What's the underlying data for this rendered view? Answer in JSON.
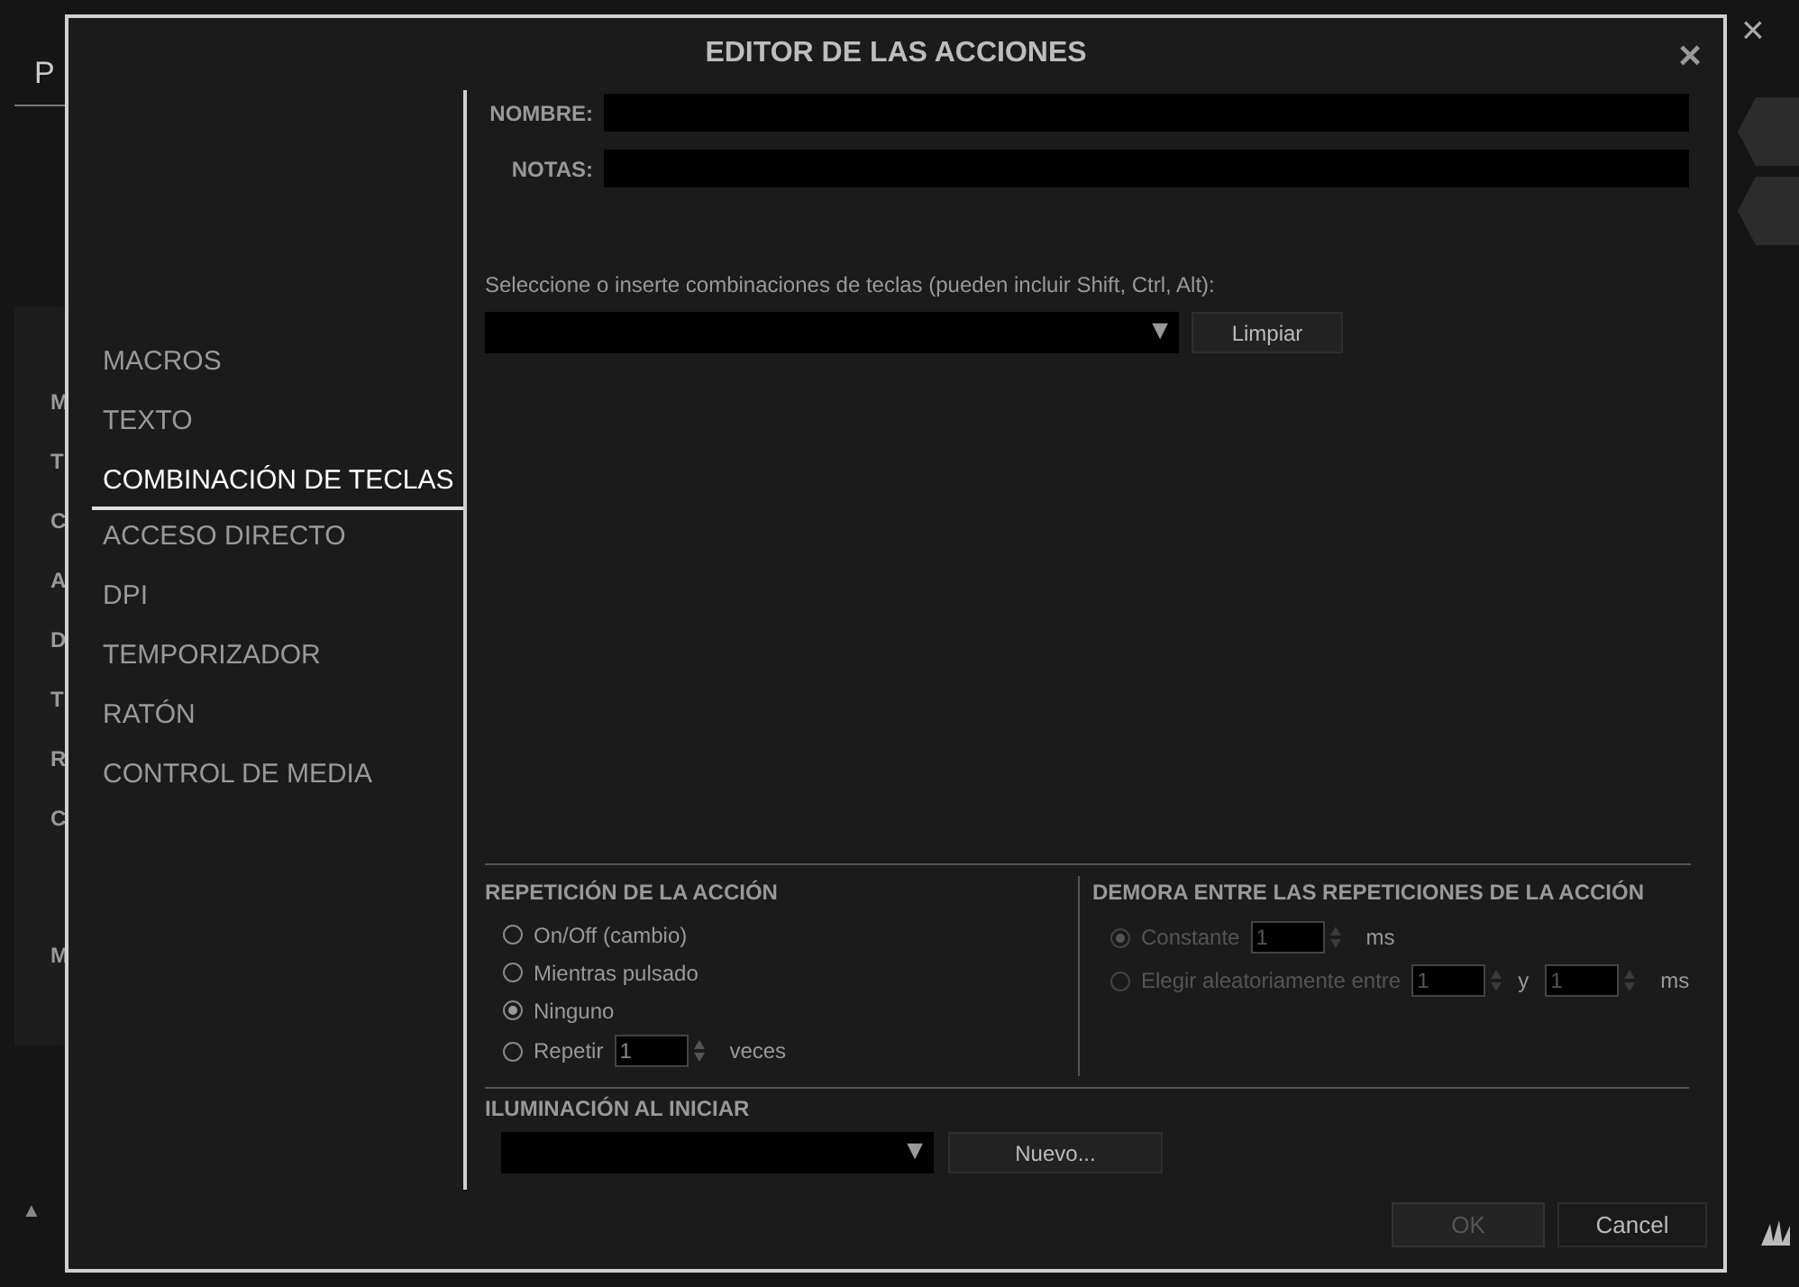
{
  "background": {
    "tab_label": "P",
    "close": "×",
    "side_letters": [
      "M",
      "T",
      "C",
      "A",
      "D",
      "T",
      "R",
      "C",
      "M"
    ],
    "corner_arrow": "▲"
  },
  "dialog": {
    "title": "EDITOR DE LAS ACCIONES",
    "close": "×",
    "sidebar": [
      {
        "label": "MACROS",
        "selected": false
      },
      {
        "label": "TEXTO",
        "selected": false
      },
      {
        "label": "COMBINACIÓN DE TECLAS",
        "selected": true
      },
      {
        "label": "ACCESO DIRECTO",
        "selected": false
      },
      {
        "label": "DPI",
        "selected": false
      },
      {
        "label": "TEMPORIZADOR",
        "selected": false
      },
      {
        "label": "RATÓN",
        "selected": false
      },
      {
        "label": "CONTROL DE MEDIA",
        "selected": false
      }
    ],
    "name_label": "NOMBRE:",
    "notes_label": "NOTAS:",
    "keys_prompt": "Seleccione o inserte combinaciones de teclas (pueden incluir Shift, Ctrl, Alt):",
    "keys_dropdown_arrow": "▼",
    "clear_button": "Limpiar",
    "repeat": {
      "title": "REPETICIÓN DE LA ACCIÓN",
      "options": [
        {
          "kind": "plain",
          "label": "On/Off (cambio)",
          "selected": false
        },
        {
          "kind": "plain",
          "label": "Mientras pulsado",
          "selected": false
        },
        {
          "kind": "plain",
          "label": "Ninguno",
          "selected": true
        },
        {
          "kind": "count",
          "label": "Repetir",
          "value": "1",
          "suffix": "veces",
          "selected": false
        }
      ]
    },
    "delay": {
      "title": "DEMORA ENTRE LAS REPETICIONES DE LA ACCIÓN",
      "disabled": true,
      "options": [
        {
          "kind": "single",
          "label": "Constante",
          "value": "1",
          "suffix": "ms",
          "selected": true
        },
        {
          "kind": "range",
          "label": "Elegir aleatoriamente entre",
          "value": "1",
          "joiner": "y",
          "value_2": "1",
          "suffix": "ms",
          "selected": false
        }
      ]
    },
    "lighting": {
      "title": "ILUMINACIÓN AL INICIAR",
      "dropdown_arrow": "▼",
      "new_button": "Nuevo..."
    },
    "buttons": [
      {
        "label": "OK",
        "disabled": true
      },
      {
        "label": "Cancel",
        "disabled": false
      }
    ]
  }
}
